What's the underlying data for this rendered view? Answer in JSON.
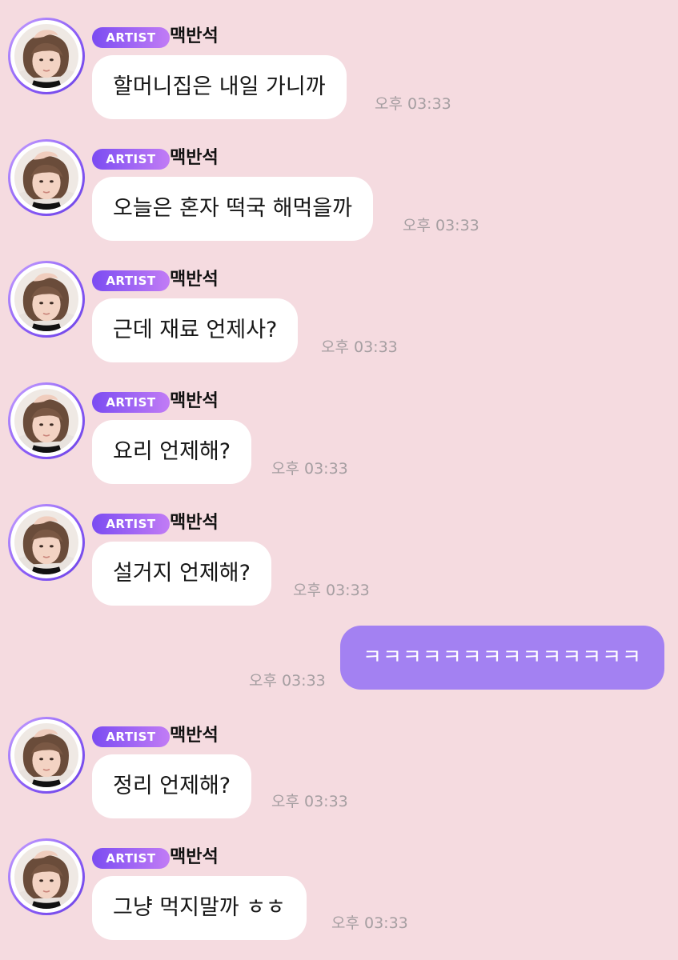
{
  "artist_badge": "ARTIST",
  "sender": "맥반석",
  "messages": [
    {
      "text": "할머니집은 내일 가니까",
      "time": "오후 03:33"
    },
    {
      "text": "오늘은 혼자 떡국 해먹을까",
      "time": "오후 03:33"
    },
    {
      "text": "근데 재료 언제사?",
      "time": "오후 03:33"
    },
    {
      "text": "요리 언제해?",
      "time": "오후 03:33"
    },
    {
      "text": "설거지 언제해?",
      "time": "오후 03:33"
    },
    {
      "text": "ㅋㅋㅋㅋㅋㅋㅋㅋㅋㅋㅋㅋㅋㅋ",
      "time": "오후 03:33"
    },
    {
      "text": "정리 언제해?",
      "time": "오후 03:33"
    },
    {
      "text": "그냥 먹지말까 ㅎㅎ",
      "time": "오후 03:33"
    }
  ],
  "colors": {
    "background": "#f5dbe0",
    "incoming_bubble": "#ffffff",
    "outgoing_bubble": "#a381f2",
    "badge_start": "#7b4cf2",
    "badge_end": "#c17cf5",
    "time_text": "#a59ea1"
  },
  "icons": {
    "avatar": "artist-profile-photo"
  }
}
